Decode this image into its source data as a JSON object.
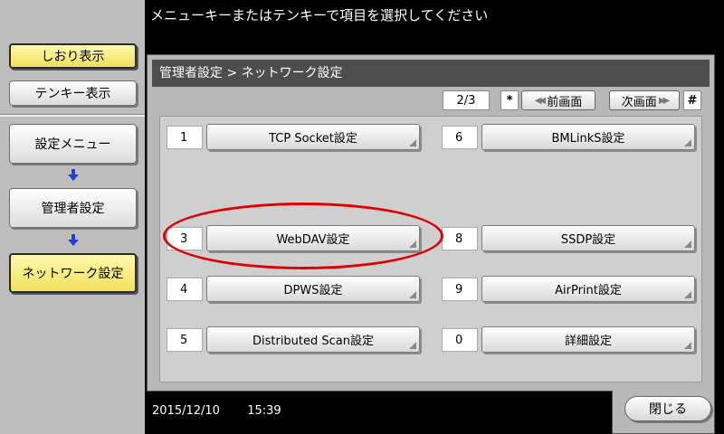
{
  "header": {
    "instruction": "メニューキーまたはテンキーで項目を選択してください"
  },
  "sidebar": {
    "bookmark_label": "しおり表示",
    "tenkey_label": "テンキー表示",
    "trail": [
      "設定メニュー",
      "管理者設定",
      "ネットワーク設定"
    ]
  },
  "breadcrumb": "管理者設定 > ネットワーク設定",
  "pager": {
    "indicator": "2/3",
    "star_key": "*",
    "prev_label": "前画面",
    "next_label": "次画面",
    "hash_key": "#"
  },
  "items": [
    {
      "num": "1",
      "label": "TCP Socket設定"
    },
    {
      "num": "6",
      "label": "BMLinkS設定"
    },
    {
      "num": "3",
      "label": "WebDAV設定"
    },
    {
      "num": "8",
      "label": "SSDP設定"
    },
    {
      "num": "4",
      "label": "DPWS設定"
    },
    {
      "num": "9",
      "label": "AirPrint設定"
    },
    {
      "num": "5",
      "label": "Distributed Scan設定"
    },
    {
      "num": "0",
      "label": "詳細設定"
    }
  ],
  "status": {
    "date": "2015/12/10",
    "time": "15:39"
  },
  "close_label": "閉じる",
  "colors": {
    "highlight": "#e00000",
    "active_yellow": "#f1e15a",
    "arrow_blue": "#1f3fe0"
  }
}
